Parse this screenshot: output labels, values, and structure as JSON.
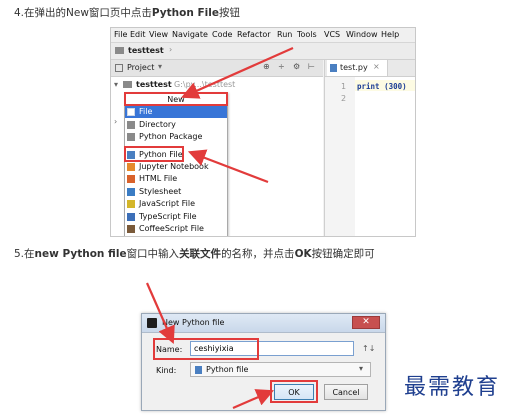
{
  "step4": {
    "prefix": "4.在弹出的New窗口页中点击",
    "bold": "Python File",
    "suffix": "按钮"
  },
  "step5": {
    "prefix": "5.在",
    "bold1": "new Python file",
    "mid1": "窗口中输入",
    "bold2": "关联文件",
    "mid2": "的名称，并点击",
    "bold3": "OK",
    "suffix": "按钮确定即可"
  },
  "ide": {
    "menu": [
      "File",
      "Edit",
      "View",
      "Navigate",
      "Code",
      "Refactor",
      "Run",
      "Tools",
      "VCS",
      "Window",
      "Help"
    ],
    "breadcrumb": "testtest",
    "project_label": "Project",
    "tree_root": "testtest",
    "tree_root_path": "G:\\py...\\testtest",
    "tab_label": "test.py",
    "line_numbers": [
      "1",
      "2"
    ],
    "code_line": "print (300)",
    "partial_text": "es",
    "menu_header": "New",
    "menu_items": [
      "File",
      "Directory",
      "Python Package",
      "Python File",
      "Jupyter Notebook",
      "HTML File",
      "Stylesheet",
      "JavaScript File",
      "TypeScript File",
      "CoffeeScript File"
    ]
  },
  "dialog": {
    "title": "New Python file",
    "name_label": "Name:",
    "name_value": "ceshiyixia",
    "sort_glyph": "↑↓",
    "kind_label": "Kind:",
    "kind_value": "Python file",
    "ok_label": "OK",
    "cancel_label": "Cancel"
  },
  "watermark": "最需教育",
  "colors": {
    "highlight_red": "#e23b3b",
    "selection_blue": "#3875d7",
    "watermark_blue": "#1f3f8f"
  }
}
